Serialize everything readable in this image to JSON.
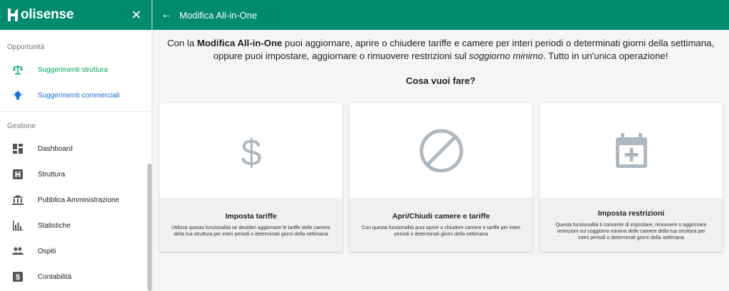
{
  "sidebar": {
    "brand": "olisense",
    "close_icon": "close-icon",
    "sections": [
      {
        "label": "Opportunità"
      },
      {
        "label": "Gestione"
      }
    ],
    "opportunity_items": [
      {
        "label": "Suggerimenti struttura",
        "icon": "balance-scale-icon",
        "color": "#00a55a"
      },
      {
        "label": "Suggerimenti commerciali",
        "icon": "lightbulb-icon",
        "color": "#1e6fd6"
      }
    ],
    "management_items": [
      {
        "label": "Dashboard",
        "icon": "dashboard-icon"
      },
      {
        "label": "Struttura",
        "icon": "hotel-icon"
      },
      {
        "label": "Pubblica Amministrazione",
        "icon": "institution-icon"
      },
      {
        "label": "Statistiche",
        "icon": "bar-chart-icon"
      },
      {
        "label": "Ospiti",
        "icon": "people-icon"
      },
      {
        "label": "Contabilità",
        "icon": "dollar-icon"
      }
    ]
  },
  "header": {
    "title": "Modifica All-in-One",
    "back_icon": "arrow-left-icon"
  },
  "main": {
    "intro_prefix": "Con la ",
    "intro_bold": "Modifica All-in-One",
    "intro_middle": " puoi aggiornare, aprire o chiudere tariffe e camere per interi periodi o determinati giorni della settimana, oppure puoi impostare, aggiornare o rimuovere restrizioni sul ",
    "intro_italic": "soggiorno minimo",
    "intro_suffix": ". Tutto in un'unica operazione!",
    "question": "Cosa vuoi fare?",
    "cards": [
      {
        "title": "Imposta tariffe",
        "description": "Utilizza questa funzionalità se desideri aggiornare le tariffe delle camere della tua struttura per interi periodi o determinati giorni della settimana",
        "icon": "dollar-icon"
      },
      {
        "title": "Apri/Chiudi camere e tariffe",
        "description": "Con questa funzionalità puoi aprire o chiudere camere e tariffe per interi periodi o determinati giorni della settimana",
        "icon": "block-icon"
      },
      {
        "title": "Imposta restrizioni",
        "description": "Questa funzionalità ti consente di impostare, rimuovere o aggiornare restrizioni sul soggiorno minimo delle camere della tua struttura per interi periodi o determinati giorni della settimana",
        "icon": "calendar-plus-icon"
      }
    ]
  },
  "colors": {
    "brand": "#008a6e",
    "icon_gray": "#b0b8bf"
  }
}
